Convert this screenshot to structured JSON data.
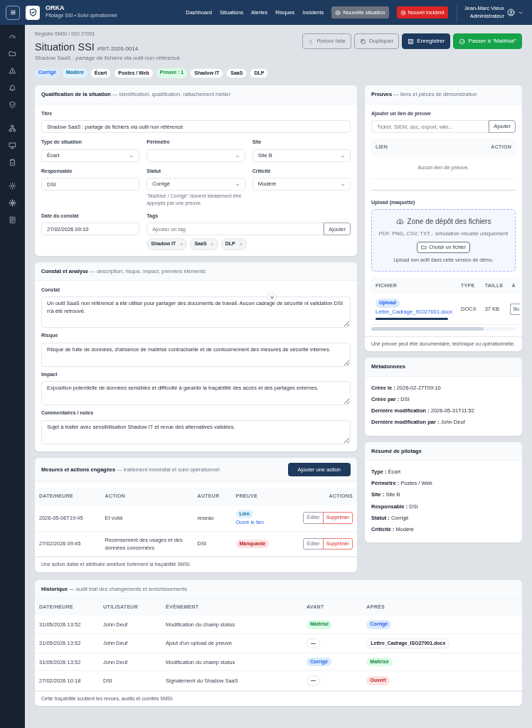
{
  "navbar": {
    "brand": {
      "name": "ORKA",
      "tagline": "Pilotage SSI • Suivi opérationnel"
    },
    "links": [
      {
        "label": "Dashboard"
      },
      {
        "label": "Situations"
      },
      {
        "label": "Alertes"
      },
      {
        "label": "Risques"
      },
      {
        "label": "Incidents"
      }
    ],
    "actions": [
      {
        "label": "Nouvelle situation",
        "kind": "secondary"
      },
      {
        "label": "Nouvel incident",
        "kind": "danger"
      }
    ],
    "user": {
      "name": "Jean-Marc Vieux",
      "role": "Administrateur"
    }
  },
  "sidebar": {
    "groups": [
      [
        {
          "selected": false
        },
        {
          "selected": false
        },
        {
          "selected": false
        },
        {
          "selected": false
        },
        {
          "selected": false
        }
      ],
      [
        {
          "selected": false
        },
        {
          "selected": false
        },
        {
          "selected": false
        }
      ],
      [
        {
          "selected": false
        },
        {
          "selected": true
        },
        {
          "selected": false
        }
      ]
    ]
  },
  "header": {
    "breadcrumb": "Registre SMSI / ISO 27001",
    "title": "Situation SSI",
    "reference": "#SIT-2026-0014",
    "subtitle": "Shadow SaaS : partage de fichiers via outil non référencé",
    "buttons": [
      {
        "label": "Retour liste",
        "kind": "back"
      },
      {
        "label": "Dupliquer",
        "kind": "duplicate"
      },
      {
        "label": "Enregistrer",
        "kind": "save"
      },
      {
        "label": "Passer à “Maîtrisé”",
        "kind": "advance"
      }
    ],
    "tags": [
      {
        "label": "Corrigé",
        "kind": "primary"
      },
      {
        "label": "Modéré",
        "kind": "info"
      },
      {
        "label": "Écart",
        "kind": "neutral"
      },
      {
        "label": "Postes / Web",
        "kind": "neutral"
      },
      {
        "label": "Preuve : 1",
        "kind": "success"
      },
      {
        "label": "Shadow IT",
        "kind": "neutral"
      },
      {
        "label": "SaaS",
        "kind": "neutral"
      },
      {
        "label": "DLP",
        "kind": "neutral"
      }
    ]
  },
  "qualification": {
    "title": "Qualification de la situation",
    "subtitle": "— identification, qualification, rattachement métier",
    "rows": [
      [
        {
          "kind": "text",
          "label": "Titre",
          "value": "Shadow SaaS : partage de fichiers via outil non référencé"
        }
      ],
      [
        {
          "kind": "select",
          "label": "Type de situation",
          "value": "Écart"
        },
        {
          "kind": "select",
          "label": "Périmètre"
        },
        {
          "kind": "select",
          "label": "Site",
          "value": "Site B"
        }
      ],
      [
        {
          "kind": "text",
          "label": "Responsable",
          "value": "DSI"
        },
        {
          "kind": "select",
          "label": "Statut",
          "value": "Corrigé",
          "help": "\"Maîtrisé / Corrigé\" doivent idéalement être appuyés par une preuve."
        },
        {
          "kind": "select",
          "label": "Criticité",
          "value": "Modéré"
        }
      ],
      [
        {
          "kind": "text",
          "label": "Date du constat",
          "value": "27/02/2026 09:10"
        },
        {
          "kind": "tags",
          "label": "Tags",
          "placeholder": "Ajouter un tag",
          "button": "Ajouter",
          "items": [
            {
              "label": "Shadow IT",
              "remove": "×"
            },
            {
              "label": "SaaS",
              "remove": "×"
            },
            {
              "label": "DLP",
              "remove": "×"
            }
          ]
        }
      ]
    ]
  },
  "findings": {
    "title": "Constat et analyse",
    "subtitle": "— description, risque, impact, premiers éléments",
    "fields": [
      {
        "label": "Constat",
        "value": "Un outil SaaS non référencé a été utilisé pour partager des documents de travail. Aucun cadrage de sécurité ni validation DSI n'a été retrouvé."
      },
      {
        "label": "Risque",
        "value": "Risque de fuite de données, d'absence de maîtrise contractuelle et de contournement des mesures de sécurité internes."
      },
      {
        "label": "Impact",
        "value": "Exposition potentielle de données sensibles et difficulté à garantir la traçabilité des accès et des partages externes."
      },
      {
        "label": "Commentaires / notes",
        "value": "Sujet à traiter avec sensibilisation Shadow IT et revue des alternatives validées."
      }
    ]
  },
  "actions": {
    "title": "Mesures et actions engagées",
    "subtitle": "— traitement immédiat et suivi opérationnel",
    "add_button": "Ajouter une action",
    "columns": [
      "DATE/HEURE",
      "ACTION",
      "AUTEUR",
      "PREUVE",
      "ACTIONS"
    ],
    "rows": [
      {
        "date": "2026-05-06T19:45",
        "action": "Et voilà",
        "author": "reseau",
        "proof": {
          "label": "Lien",
          "kind": "info",
          "link": "Ouvrir le lien"
        },
        "edit": "Éditer",
        "delete": "Supprimer"
      },
      {
        "date": "27/02/2026 09:45",
        "action": "Recensement des usages et des données concernées",
        "author": "DSI",
        "proof": {
          "label": "Manquante",
          "kind": "danger"
        },
        "edit": "Éditer",
        "delete": "Supprimer"
      }
    ],
    "footer": "Une action datée et attribuée améliore fortement la traçabilité SMSI."
  },
  "proofs": {
    "title": "Preuves",
    "subtitle": "— liens et pièces de démonstration",
    "link_label": "Ajouter un lien de preuve",
    "link_placeholder": "Ticket, SIEM, doc, export, wiki...",
    "add_button": "Ajouter",
    "links_columns": [
      "LIEN",
      "ACTION"
    ],
    "links_empty": "Aucun lien de preuve.",
    "upload_label": "Upload (maquette)",
    "dropzone": {
      "title": "Zone de dépôt des fichiers",
      "formats": "PDF, PNG, CSV, TXT... simulation visuelle uniquement",
      "button": "Choisir un fichier",
      "note": "Upload non actif dans cette version de démo."
    },
    "files_columns": [
      "FICHIER",
      "TYPE",
      "TAILLE",
      "A"
    ],
    "files": [
      {
        "badge": "Upload",
        "name": "Lettre_Cadrage_ISO27001.docx",
        "level": 1,
        "type": "DOCX",
        "size": "37 KB",
        "action": "Su"
      }
    ],
    "footer": "Une preuve peut être documentaire, technique ou opérationnelle."
  },
  "metadata": {
    "title": "Métadonnées",
    "lines": [
      {
        "label": "Créée le :",
        "value": "2026-02-27T09:10"
      },
      {
        "label": "Créée par :",
        "value": "DSI"
      },
      {
        "label": "Dernière modification :",
        "value": "2026-05-31T11:52"
      },
      {
        "label": "Dernière modification par :",
        "value": "John Deuf"
      }
    ]
  },
  "summary": {
    "title": "Résumé de pilotage",
    "lines": [
      {
        "label": "Type :",
        "value": "Écart"
      },
      {
        "label": "Périmètre :",
        "value": "Postes / Web"
      },
      {
        "label": "Site :",
        "value": "Site B"
      },
      {
        "label": "Responsable :",
        "value": "DSI"
      },
      {
        "label": "Statut :",
        "value": "Corrigé"
      },
      {
        "label": "Criticité :",
        "value": "Modéré"
      }
    ]
  },
  "history": {
    "title": "Historique",
    "subtitle": "— audit trail des changements et enrichissements",
    "columns": [
      "DATE/HEURE",
      "UTILISATEUR",
      "ÉVÉNEMENT",
      "AVANT",
      "APRÈS"
    ],
    "rows": [
      {
        "date": "31/05/2026 13:52",
        "user": "John Deuf",
        "event": "Modification du champ status",
        "before": {
          "label": "Maîtrisé",
          "kind": "success"
        },
        "after": {
          "label": "Corrigé",
          "kind": "primary"
        }
      },
      {
        "date": "31/05/2026 13:52",
        "user": "John Deuf",
        "event": "Ajout d'un upload de preuve",
        "before": {
          "label": "—",
          "kind": "neutral"
        },
        "after": {
          "label": "Lettre_Cadrage_ISO27001.docx",
          "kind": "neutral"
        }
      },
      {
        "date": "31/05/2026 13:52",
        "user": "John Deuf",
        "event": "Modification du champ status",
        "before": {
          "label": "Corrigé",
          "kind": "primary"
        },
        "after": {
          "label": "Maîtrisé",
          "kind": "success"
        }
      },
      {
        "date": "27/02/2026 10:18",
        "user": "DSI",
        "event": "Signalement du Shadow SaaS",
        "before": {
          "label": "—",
          "kind": "neutral"
        },
        "after": {
          "label": "Ouvert",
          "kind": "danger"
        }
      }
    ],
    "footer": "Cette traçabilité soutient les revues, audits et comités SMSI."
  }
}
